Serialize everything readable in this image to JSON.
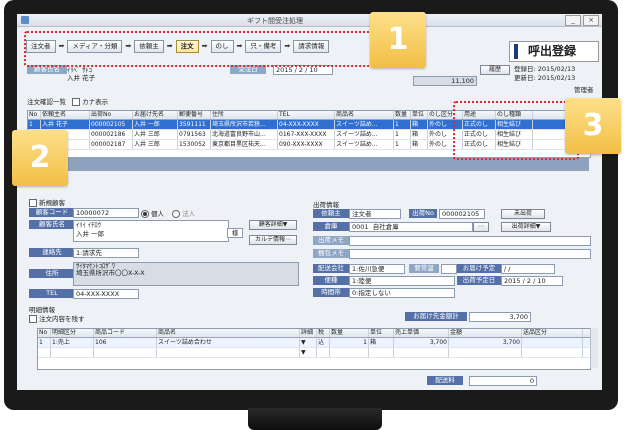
{
  "window": {
    "title": "ギフト間受注処理"
  },
  "flow_steps": [
    "注文者",
    "メディア・分類",
    "依頼主",
    "注文",
    "のし",
    "只・備考",
    "請求情報"
  ],
  "flow_current_index": 3,
  "header": {
    "screen_title": "呼出登録",
    "registered_label": "登録日:",
    "registered_date": "2015/02/13",
    "updated_label": "更新日:",
    "updated_date": "2015/02/13",
    "manager": "管理者"
  },
  "top": {
    "customer_name_label": "顧客氏名",
    "customer_kana": "ｲﾘﾍﾞ ｻﾄｺ",
    "customer_name": "入井 花子",
    "reception_label": "受注日",
    "reception_date": "2015 / 2 / 10",
    "history_button": "履歴",
    "amount": "11,100"
  },
  "order_list": {
    "title": "注文確認一覧",
    "kana_toggle": "カナ表示",
    "columns": [
      "No",
      "依頼主名",
      "出荷No",
      "お届け先名",
      "郵便番号",
      "住所",
      "TEL",
      "商品名",
      "数量",
      "単位",
      "のし区分",
      "用途",
      "のし種類"
    ],
    "rows": [
      [
        "1",
        "入井 花子",
        "000002105",
        "入井 一郎",
        "3591111",
        "埼玉県所沢市若狭...",
        "04-XXX-XXXX",
        "スイーツ詰め...",
        "1",
        "箱",
        "外のし",
        "正式のし",
        "相生結び"
      ],
      [
        "2",
        "",
        "000002186",
        "入井 三郎",
        "0791563",
        "北海道富良野市山...",
        "0167-XXX-XXXX",
        "スイーツ詰め...",
        "1",
        "箱",
        "外のし",
        "正式のし",
        "相生結び"
      ],
      [
        "3",
        "",
        "000002187",
        "入井 三郎",
        "1530052",
        "東京都目黒区祐天...",
        "090-XXX-XXXX",
        "スイーツ詰め...",
        "1",
        "箱",
        "外のし",
        "正式のし",
        "相生結び"
      ]
    ]
  },
  "customer": {
    "new_customer": "新規顧客",
    "code_label": "顧客コード",
    "code": "10000072",
    "individual": "個人",
    "corporate": "法人",
    "name_label": "顧客氏名",
    "kana": "ｲﾘｲ ｲﾁﾛｳ",
    "name": "入井 一郎",
    "honorific": "様",
    "details_button": "顧客詳細▼",
    "karte_button": "カルテ情報⋯",
    "contact_label": "連絡先",
    "contact_value": "1:請求先",
    "address_label": "住所",
    "address_kana": "ｻｲﾀﾏｹﾝﾄｺﾛｻﾞﾜ",
    "address_line1": "埼玉県所沢市〇〇X-X-X",
    "tel_label": "TEL",
    "tel": "04-XXX-XXXX"
  },
  "shipping": {
    "title": "出荷情報",
    "requester_label": "依頼主",
    "requester_value": "注文者",
    "ship_no_label": "出荷No",
    "ship_no": "000002105",
    "unshipped": "未出荷",
    "warehouse_label": "倉庫",
    "warehouse_code": "0001",
    "warehouse_name": "自社倉庫",
    "ship_detail_button": "出荷詳細▼",
    "ship_memo_label": "出荷メモ",
    "delivery_memo_label": "梱包メモ",
    "carrier_label": "配送会社",
    "carrier_value": "1:佐川急便",
    "temp_label": "要常温",
    "delivery_date_label": "お届け予定",
    "delivery_date": "/    /",
    "service_label": "便種",
    "service_value": "1:陸便",
    "ship_date_label": "出荷予定日",
    "ship_date": "2015 / 2 / 10",
    "time_label": "時間帯",
    "time_value": "0:指定しない"
  },
  "details": {
    "title": "明細情報",
    "copy_label": "注文内容を残す",
    "delivery_total_label": "お届け先金額計",
    "delivery_total": "3,700",
    "columns": [
      "No",
      "明細区分",
      "商品コード",
      "商品名",
      "詳細",
      "税",
      "数量",
      "単位",
      "売上単価",
      "金額",
      "送品区分"
    ],
    "rows": [
      [
        "1",
        "1:売上",
        "106",
        "スイーツ詰め合わせ",
        "▼",
        "込",
        "1",
        "箱",
        "3,700",
        "3,700",
        ""
      ],
      [
        "",
        "",
        "",
        "",
        "▼",
        "",
        "",
        "",
        "",
        "",
        ""
      ]
    ],
    "shipping_fee_label": "配送料",
    "shipping_fee": "0"
  },
  "callouts": [
    "1",
    "2",
    "3"
  ]
}
